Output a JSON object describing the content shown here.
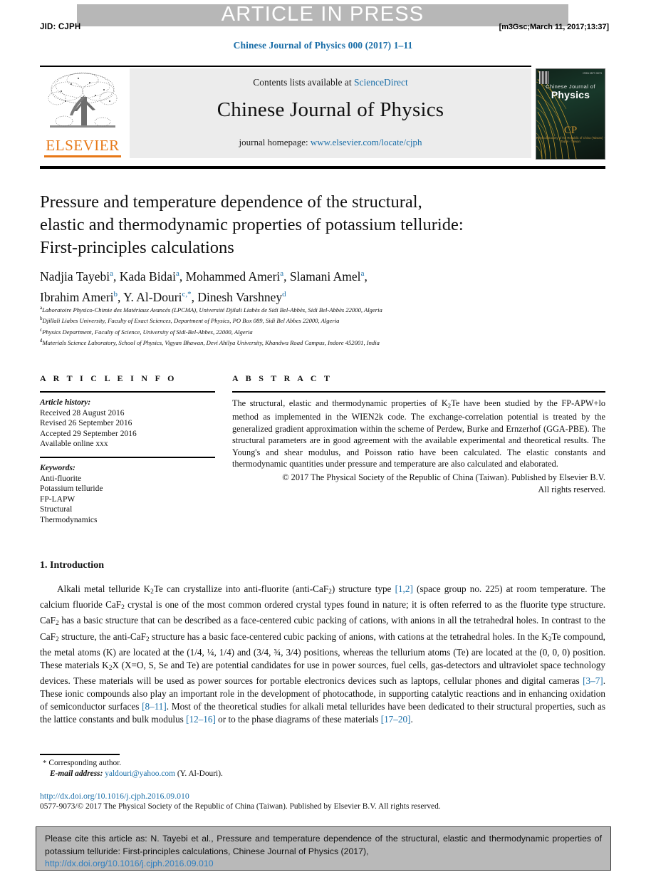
{
  "banner": {
    "text": "ARTICLE IN PRESS",
    "band_color": "#b7b7b7"
  },
  "running_head": {
    "jid": "JID: CJPH",
    "stamp": "[m3Gsc;March 11, 2017;13:37]"
  },
  "journal_reference": "Chinese Journal of Physics 000 (2017) 1–11",
  "masthead": {
    "contents_prefix": "Contents lists available at ",
    "contents_link": "ScienceDirect",
    "journal_name": "Chinese Journal of Physics",
    "homepage_prefix": "journal homepage: ",
    "homepage_url": "www.elsevier.com/locate/cjph",
    "publisher_logo_text": "ELSEVIER",
    "cover": {
      "title_small": "Chinese Journal of",
      "title_large": "Physics",
      "society_mark": "CP",
      "society_sub": "Physical Society of the Republic of China (Taiwan) · Taipei · Taiwan"
    }
  },
  "article": {
    "title_lines": [
      "Pressure and temperature dependence of the structural,",
      "elastic and thermodynamic properties of potassium telluride:",
      "First-principles calculations"
    ],
    "authors_line_1": [
      {
        "name": "Nadjia Tayebi",
        "sup": "a"
      },
      {
        "name": "Kada Bidai",
        "sup": "a"
      },
      {
        "name": "Mohammed Ameri",
        "sup": "a"
      },
      {
        "name": "Slamani Amel",
        "sup": "a"
      }
    ],
    "authors_line_2": [
      {
        "name": "Ibrahim Ameri",
        "sup": "b"
      },
      {
        "name": "Y. Al-Douri",
        "sup": "c,*"
      },
      {
        "name": "Dinesh Varshney",
        "sup": "d"
      }
    ],
    "affiliations": [
      {
        "mark": "a",
        "text": "Laboratoire Physico-Chimie des Matériaux Avancés (LPCMA), Université Djilali Liabès de Sidi Bel-Abbès, Sidi Bel-Abbès 22000, Algeria"
      },
      {
        "mark": "b",
        "text": "Djillali Liabes University, Faculty of Exact Sciences, Department of Physics, PO Box 089, Sidi Bel Abbes 22000, Algeria"
      },
      {
        "mark": "c",
        "text": "Physics Department, Faculty of Science, University of Sidi-Bel-Abbes, 22000, Algeria"
      },
      {
        "mark": "d",
        "text": "Materials Science Laboratory, School of Physics, Vigyan Bhawan, Devi Ahilya University, Khandwa Road Campus, Indore 452001, India"
      }
    ]
  },
  "article_info": {
    "heading": "A R T I C L E   I N F O",
    "history_label": "Article history:",
    "history": [
      "Received 28 August 2016",
      "Revised 26 September 2016",
      "Accepted 29 September 2016",
      "Available online xxx"
    ],
    "keywords_label": "Keywords:",
    "keywords": [
      "Anti-fluorite",
      "Potassium telluride",
      "FP-LAPW",
      "Structural",
      "Thermodynamics"
    ]
  },
  "abstract": {
    "heading": "A B S T R A C T",
    "body": "The structural, elastic and thermodynamic properties of K2Te have been studied by the FP-APW+lo method as implemented in the WIEN2k code. The exchange-correlation potential is treated by the generalized gradient approximation within the scheme of Perdew, Burke and Ernzerhof (GGA-PBE). The structural parameters are in good agreement with the available experimental and theoretical results. The Young's and shear modulus, and Poisson ratio have been calculated. The elastic constants and thermodynamic quantities under pressure and temperature are also calculated and elaborated.",
    "copyright_line_1": "© 2017 The Physical Society of the Republic of China (Taiwan). Published by Elsevier B.V.",
    "copyright_line_2": "All rights reserved."
  },
  "introduction": {
    "heading": "1. Introduction",
    "paragraph": "Alkali metal telluride K2Te can crystallize into anti-fluorite (anti-CaF2) structure type [1,2] (space group no. 225) at room temperature. The calcium fluoride CaF2 crystal is one of the most common ordered crystal types found in nature; it is often referred to as the fluorite type structure. CaF2 has a basic structure that can be described as a face-centered cubic packing of cations, with anions in all the tetrahedral holes. In contrast to the CaF2 structure, the anti-CaF2 structure has a basic face-centered cubic packing of anions, with cations at the tetrahedral holes. In the K2Te compound, the metal atoms (K) are located at the (1/4, ¼, 1/4) and (3/4, ¾, 3/4) positions, whereas the tellurium atoms (Te) are located at the (0, 0, 0) position. These materials K2X (X=O, S, Se and Te) are potential candidates for use in power sources, fuel cells, gas-detectors and ultraviolet space technology devices. These materials will be used as power sources for portable electronics devices such as laptops, cellular phones and digital cameras [3–7]. These ionic compounds also play an important role in the development of photocathode, in supporting catalytic reactions and in enhancing oxidation of semiconductor surfaces [8–11]. Most of the theoretical studies for alkali metal tellurides have been dedicated to their structural properties, such as the lattice constants and bulk modulus [12–16] or to the phase diagrams of these materials [17–20].",
    "citations": [
      "[1,2]",
      "[3–7]",
      "[8–11]",
      "[12–16]",
      "[17–20]"
    ]
  },
  "footnotes": {
    "corresponding_marker": "*",
    "corresponding_text": "Corresponding author.",
    "email_label": "E-mail address:",
    "email": "yaldouri@yahoo.com",
    "email_owner": "(Y. Al-Douri).",
    "doi_url": "http://dx.doi.org/10.1016/j.cjph.2016.09.010",
    "issn_line": "0577-9073/© 2017 The Physical Society of the Republic of China (Taiwan). Published by Elsevier B.V. All rights reserved."
  },
  "citation_box": {
    "text": "Please cite this article as: N. Tayebi et al., Pressure and temperature dependence of the structural, elastic and thermodynamic properties of potassium telluride: First-principles calculations, Chinese Journal of Physics (2017),",
    "doi": "http://dx.doi.org/10.1016/j.cjph.2016.09.010"
  },
  "colors": {
    "link": "#1a6ea8",
    "elsevier_orange": "#e77817",
    "banner_gray": "#b7b7b7",
    "citation_box_bg": "#b9b9b9"
  }
}
